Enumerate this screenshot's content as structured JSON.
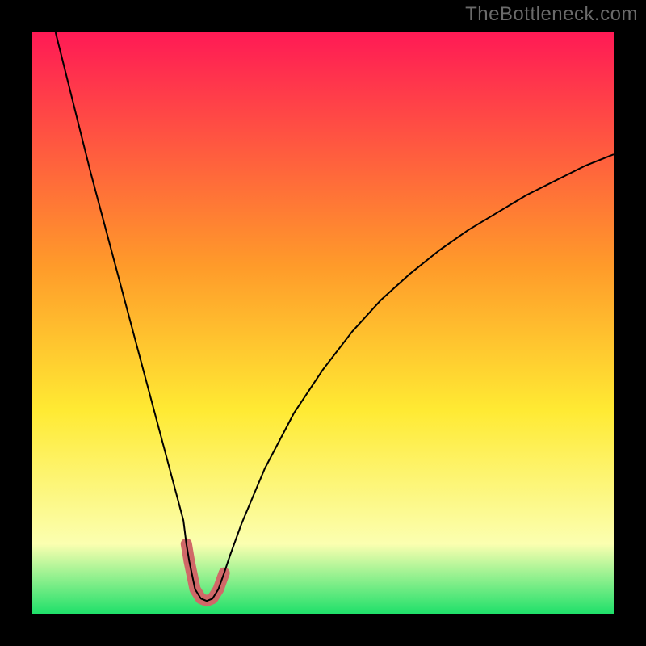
{
  "watermark": "TheBottleneck.com",
  "chart_data": {
    "type": "line",
    "title": "",
    "xlabel": "",
    "ylabel": "",
    "xlim": [
      0,
      100
    ],
    "ylim": [
      0,
      100
    ],
    "background_gradient": {
      "top_color": "#ff1a55",
      "mid1": {
        "pos": 0.4,
        "color": "#ff9a2a"
      },
      "mid2": {
        "pos": 0.65,
        "color": "#ffea33"
      },
      "mid3": {
        "pos": 0.88,
        "color": "#fbffb0"
      },
      "bottom_color": "#1fe06a"
    },
    "series": [
      {
        "name": "bottleneck-curve",
        "color": "#000000",
        "width": 2,
        "x": [
          4,
          6,
          8,
          10,
          12,
          14,
          16,
          18,
          20,
          22,
          24,
          26,
          26.5,
          27,
          28,
          29,
          30,
          31,
          32,
          33,
          34,
          36,
          40,
          45,
          50,
          55,
          60,
          65,
          70,
          75,
          80,
          85,
          90,
          95,
          100
        ],
        "y": [
          100,
          92,
          84,
          76,
          68.5,
          61,
          53.5,
          46,
          38.5,
          31,
          23.5,
          16,
          12,
          9,
          4.2,
          2.6,
          2.2,
          2.6,
          4.2,
          7,
          10,
          15.5,
          25,
          34.5,
          42,
          48.5,
          54,
          58.5,
          62.5,
          66,
          69,
          72,
          74.5,
          77,
          79
        ]
      },
      {
        "name": "highlight-minimum",
        "color": "#d06868",
        "width": 14,
        "linecap": "round",
        "x": [
          26.5,
          27,
          28,
          29,
          30,
          31,
          32,
          33
        ],
        "y": [
          12,
          9,
          4.2,
          2.6,
          2.2,
          2.6,
          4.2,
          7
        ]
      }
    ],
    "colors": {
      "curve": "#000000",
      "highlight": "#d06868",
      "frame": "#000000"
    }
  }
}
